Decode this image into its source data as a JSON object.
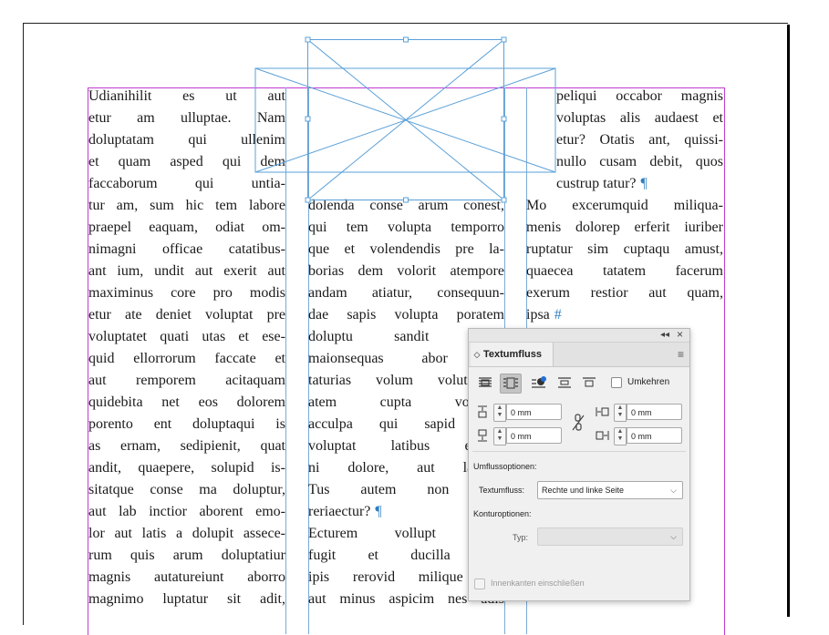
{
  "document": {
    "columns": [
      {
        "lines": [
          "Udianihilit es ut aut",
          "etur am ulluptae. Nam",
          "doluptatam qui ullenim",
          "et quam asped qui dem",
          "faccaborum qui untia-",
          "tur am, sum hic tem labore",
          "praepel eaquam, odiat om-",
          "nimagni officae catatibus-",
          "ant ium, undit aut exerit aut",
          "maximinus core pro modis",
          "etur ate deniet voluptat pre",
          "voluptatet quati utas et ese-",
          "quid ellorrorum faccate et",
          "aut remporem acitaquam",
          "quidebita net eos dolorem",
          "porento ent doluptaqui is",
          "as ernam, sedipienit, quat",
          "andit, quaepere, solupid is-",
          "sitatque conse ma doluptur,",
          "aut lab inctior aborent emo-",
          "lor aut latis a dolupit assece-",
          "rum quis arum doluptatiur",
          "magnis autatureiunt aborro",
          "magnimo luptatur sit adit,"
        ]
      },
      {
        "lines": [
          "dolenda conse arum conest,",
          "qui tem volupta temporro",
          "que et volendendis pre la-",
          "borias dem volorit atempore",
          "andam atiatur, consequun-",
          "dae sapis volupta poratem",
          "doluptu sandit aspeli",
          "maionsequas abor mo",
          "taturias volum volut es",
          "atem cupta voluptas",
          "acculpa qui sapid mol",
          "voluptat latibus eriorro",
          "ni dolore, aut laborio",
          "Tus autem non pror",
          "reriaectur?",
          "Ecturem vollupt aeper",
          "fugit et ducilla non",
          "ipis rerovid milique vic",
          "aut minus aspicim nes adis"
        ]
      },
      {
        "lines_top": [
          "peliqui occabor magnis",
          "voluptas alis audaest et",
          "etur? Otatis ant, quissi-",
          "nullo cusam debit, quos",
          "custrup tatur?"
        ],
        "lines_bottom": [
          "Mo excerumquid miliqua-",
          "menis dolorep erferit iuriber",
          "ruptatur sim cuptaqu amust,",
          "quaecea tatatem facerum",
          "exerum restior aut quam,",
          "ipsa"
        ]
      }
    ],
    "pilcrow": "¶",
    "end_mark": "#"
  },
  "panel": {
    "collapse_glyph": "◂◂",
    "close_glyph": "×",
    "tab_chevron": "◇",
    "title": "Textumfluss",
    "menu_glyph": "≡",
    "invert_label": "Umkehren",
    "offsets": {
      "top": "0 mm",
      "bottom": "0 mm",
      "left": "0 mm",
      "right": "0 mm"
    },
    "wrap_options_heading": "Umflussoptionen:",
    "wrap_to_label": "Textumfluss:",
    "wrap_to_value": "Rechte und linke Seite",
    "contour_heading": "Konturoptionen:",
    "type_label": "Typ:",
    "type_value": "",
    "include_inside_edges_label": "Innenkanten einschließen",
    "colors": {
      "active_button": "#c4c4c4",
      "accent_dot": "#1f6fd6"
    }
  }
}
